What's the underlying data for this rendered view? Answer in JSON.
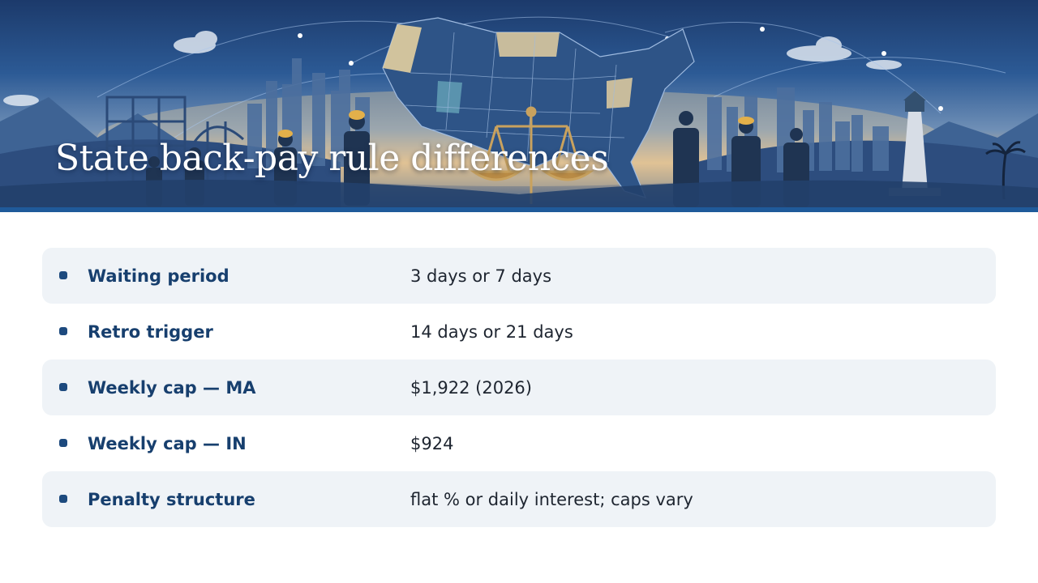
{
  "slide": {
    "title": "State back-pay rule differences"
  },
  "rules": [
    {
      "label": "Waiting period",
      "value": "3 days or 7 days"
    },
    {
      "label": "Retro trigger",
      "value": "14 days or 21 days"
    },
    {
      "label": "Weekly cap — MA",
      "value": "$1,922 (2026)"
    },
    {
      "label": "Weekly cap — IN",
      "value": "$924"
    },
    {
      "label": "Penalty structure",
      "value": "flat % or daily interest; caps vary"
    }
  ],
  "banner": {
    "illustration": "us-map-skyline-scales-workers",
    "colors": {
      "sky_top": "#1c3a6b",
      "map_blue": "#2e5487",
      "map_highlight": "#e3cfa0",
      "accent": "#1f5a9a"
    }
  }
}
